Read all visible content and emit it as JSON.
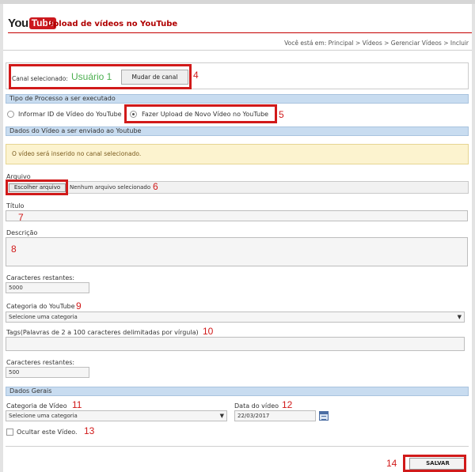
{
  "header": {
    "logo_you": "You",
    "logo_tube": "Tube",
    "title": "Upload de vídeos no YouTube",
    "breadcrumb": "Você está em: Principal > Vídeos > Gerenciar Vídeos > Incluir"
  },
  "canal": {
    "label": "Canal selecionado:",
    "user": "Usuário 1",
    "button": "Mudar de canal"
  },
  "processo": {
    "section": "Tipo de Processo a ser executado",
    "option1": "Informar ID de Vídeo do YouTube",
    "option2": "Fazer Upload de Novo Vídeo no YouTube",
    "selected": "option2"
  },
  "dados_video": {
    "section": "Dados do Vídeo a ser enviado ao Youtube",
    "alert": "O vídeo será inserido no canal selecionado.",
    "arquivo_label": "Arquivo",
    "arquivo_button": "Escolher arquivo",
    "arquivo_status": "Nenhum arquivo selecionado",
    "titulo_label": "Título",
    "descricao_label": "Descrição",
    "caracteres_label": "Caracteres restantes:",
    "caracteres_value": "5000",
    "categoria_label": "Categoria do YouTube",
    "categoria_value": "Selecione uma categoria",
    "tags_label": "Tags(Palavras de 2 a 100 caracteres delimitadas por vírgula)",
    "tags_caracteres_label": "Caracteres restantes:",
    "tags_caracteres_value": "500"
  },
  "dados_gerais": {
    "section": "Dados Gerais",
    "categoria_label": "Categoria de Vídeo",
    "categoria_value": "Selecione uma categoria",
    "data_label": "Data do vídeo",
    "data_value": "22/03/2017",
    "ocultar_label": "Ocultar este Vídeo."
  },
  "actions": {
    "salvar": "SALVAR"
  },
  "annotations": {
    "n4": "4",
    "n5": "5",
    "n6": "6",
    "n7": "7",
    "n8": "8",
    "n9": "9",
    "n10": "10",
    "n11": "11",
    "n12": "12",
    "n13": "13",
    "n14": "14"
  },
  "colors": {
    "brand_red": "#cc181e",
    "title_red": "#b00000",
    "annotation_red": "#d11a1a",
    "section_blue": "#c8dcf0",
    "alert_yellow": "#fcf3cf",
    "user_green": "#4caf50"
  }
}
